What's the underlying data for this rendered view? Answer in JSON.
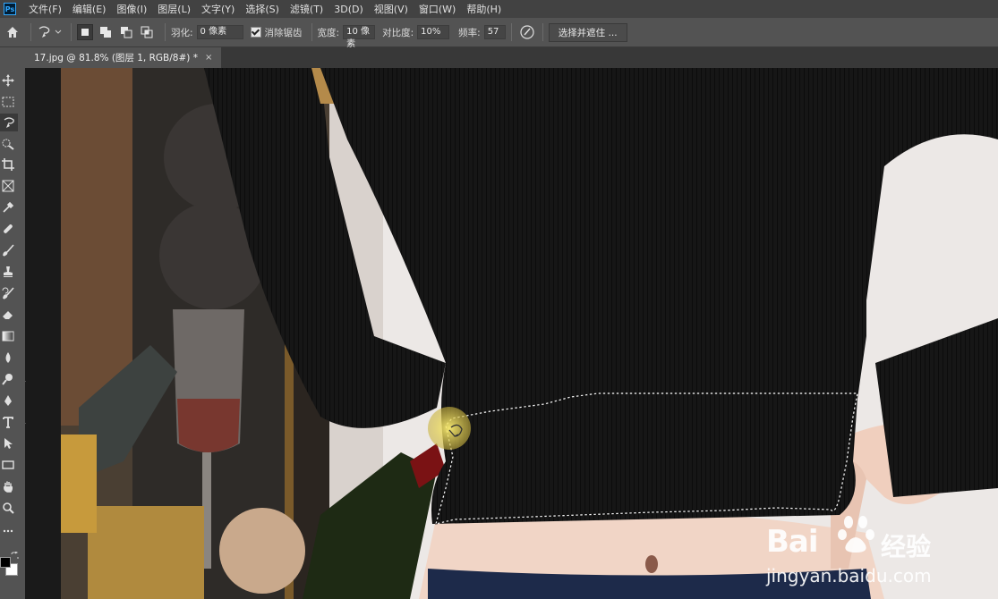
{
  "menubar": {
    "app_icon": "Ps",
    "items": [
      "文件(F)",
      "编辑(E)",
      "图像(I)",
      "图层(L)",
      "文字(Y)",
      "选择(S)",
      "滤镜(T)",
      "3D(D)",
      "视图(V)",
      "窗口(W)",
      "帮助(H)"
    ]
  },
  "options": {
    "feather_label": "羽化:",
    "feather_value": "0 像素",
    "antialias_label": "消除锯齿",
    "width_label": "宽度:",
    "width_value": "10 像素",
    "contrast_label": "对比度:",
    "contrast_value": "10%",
    "frequency_label": "频率:",
    "frequency_value": "57",
    "select_mask_label": "选择并遮住 ..."
  },
  "document": {
    "tab_title": "17.jpg @ 81.8% (图层 1, RGB/8#) *",
    "close_glyph": "×"
  },
  "watermark": {
    "brand_left": "Bai",
    "brand_right": "经验",
    "url": "jingyan.baidu.com"
  },
  "colors": {
    "foreground": "#000000",
    "background": "#ffffff",
    "accent": "#31a8ff"
  },
  "icons": [
    "home-icon",
    "magnetic-lasso-icon",
    "new-selection-icon",
    "add-selection-icon",
    "subtract-selection-icon",
    "intersect-selection-icon",
    "pen-pressure-icon",
    "move-icon",
    "marquee-icon",
    "lasso-icon",
    "quick-select-icon",
    "crop-icon",
    "frame-icon",
    "eyedropper-icon",
    "healing-icon",
    "brush-icon",
    "stamp-icon",
    "history-brush-icon",
    "eraser-icon",
    "gradient-icon",
    "blur-icon",
    "dodge-icon",
    "pen-icon",
    "type-icon",
    "path-select-icon",
    "rectangle-icon",
    "hand-icon",
    "zoom-icon",
    "more-icon"
  ]
}
